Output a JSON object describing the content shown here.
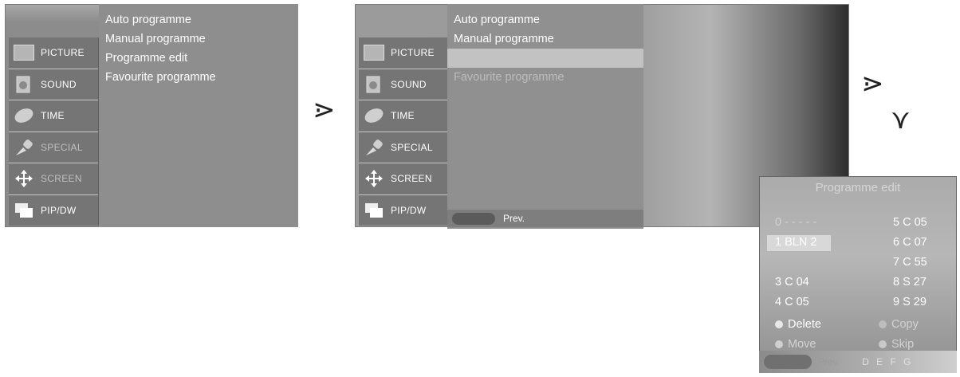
{
  "sidebar": {
    "items": [
      {
        "label": "PICTURE",
        "icon": "picture-icon"
      },
      {
        "label": "SOUND",
        "icon": "sound-icon"
      },
      {
        "label": "TIME",
        "icon": "time-icon"
      },
      {
        "label": "SPECIAL",
        "icon": "special-icon"
      },
      {
        "label": "SCREEN",
        "icon": "screen-icon"
      },
      {
        "label": "PIP/DW",
        "icon": "pipdw-icon"
      }
    ]
  },
  "menu": {
    "items": [
      "Auto programme",
      "Manual programme",
      "Programme edit",
      "Favourite programme"
    ]
  },
  "arrows": {
    "right": "⋗",
    "down": "⋎"
  },
  "prev_label": "Prev.",
  "programme_edit": {
    "title": "Programme edit",
    "left_rows": [
      "0 - - - - -",
      "1 BLN 2",
      "",
      "3 C 04",
      "4 C 05"
    ],
    "right_rows": [
      "5 C 05",
      "6 C 07",
      "7 C 55",
      "8 S 27",
      "9 S 29"
    ],
    "actions": {
      "delete": "Delete",
      "move": "Move",
      "copy": "Copy",
      "skip": "Skip"
    },
    "colors": {
      "delete": "#e8e8e8",
      "move": "#cfcfcf",
      "copy": "#bdbdbd",
      "skip": "#c9c9c9"
    },
    "bottom_letters": "D E F G",
    "bottom_prev": "Prev."
  }
}
